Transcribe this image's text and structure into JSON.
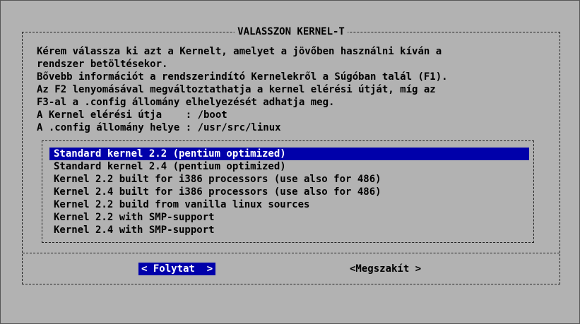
{
  "dialog": {
    "title": "VALASSZON KERNEL-T",
    "lines": [
      "Kérem válassza ki azt a Kernelt, amelyet a jövőben használni kíván a",
      "rendszer betöltésekor.",
      "Bővebb információt a rendszerindító Kernelekről a Súgóban talál (F1).",
      "Az F2 lenyomásával megváltoztathatja a kernel elérési útját, míg az",
      "F3-al a .config állomány elhelyezését adhatja meg.",
      "A Kernel elérési útja    : /boot",
      "A .config állomány helye : /usr/src/linux"
    ]
  },
  "kernel_list": {
    "selected_index": 0,
    "items": [
      "Standard kernel 2.2 (pentium optimized)",
      "Standard kernel 2.4 (pentium optimized)",
      "Kernel 2.2 built for i386 processors (use also for 486)",
      "Kernel 2.4 built for i386 processors (use also for 486)",
      "Kernel 2.2 build from vanilla linux sources",
      "Kernel 2.2 with SMP-support",
      "Kernel 2.4 with SMP-support"
    ]
  },
  "buttons": {
    "continue_label": "< Folytat  >",
    "cancel_label": "<Megszakít >"
  },
  "colors": {
    "background": "#b2b2b2",
    "highlight": "#0000aa",
    "highlight_text": "#ffffff"
  }
}
